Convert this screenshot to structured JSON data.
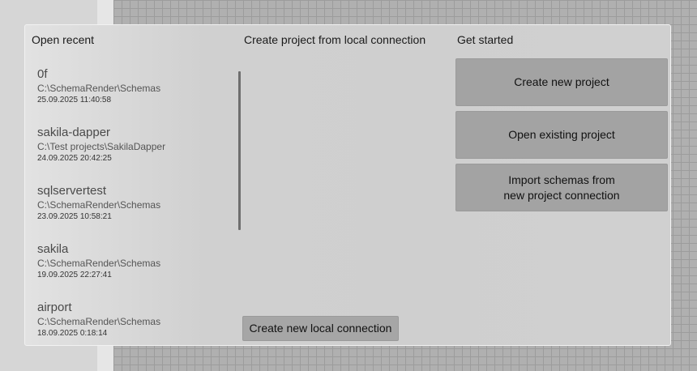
{
  "sections": {
    "open_recent": "Open recent",
    "local_connection": "Create project from local connection",
    "get_started": "Get started"
  },
  "recent": [
    {
      "name": "0f",
      "path": "C:\\SchemaRender\\Schemas",
      "date": "25.09.2025 11:40:58"
    },
    {
      "name": "sakila-dapper",
      "path": "C:\\Test projects\\SakilaDapper",
      "date": "24.09.2025 20:42:25"
    },
    {
      "name": "sqlservertest",
      "path": "C:\\SchemaRender\\Schemas",
      "date": "23.09.2025 10:58:21"
    },
    {
      "name": "sakila",
      "path": "C:\\SchemaRender\\Schemas",
      "date": "19.09.2025 22:27:41"
    },
    {
      "name": "airport",
      "path": "C:\\SchemaRender\\Schemas",
      "date": "18.09.2025 0:18:14"
    }
  ],
  "buttons": {
    "create_new_project": "Create new project",
    "open_existing_project": "Open existing project",
    "import_line1": "Import schemas from",
    "import_line2": "new project connection",
    "create_local_connection": "Create new local connection"
  }
}
